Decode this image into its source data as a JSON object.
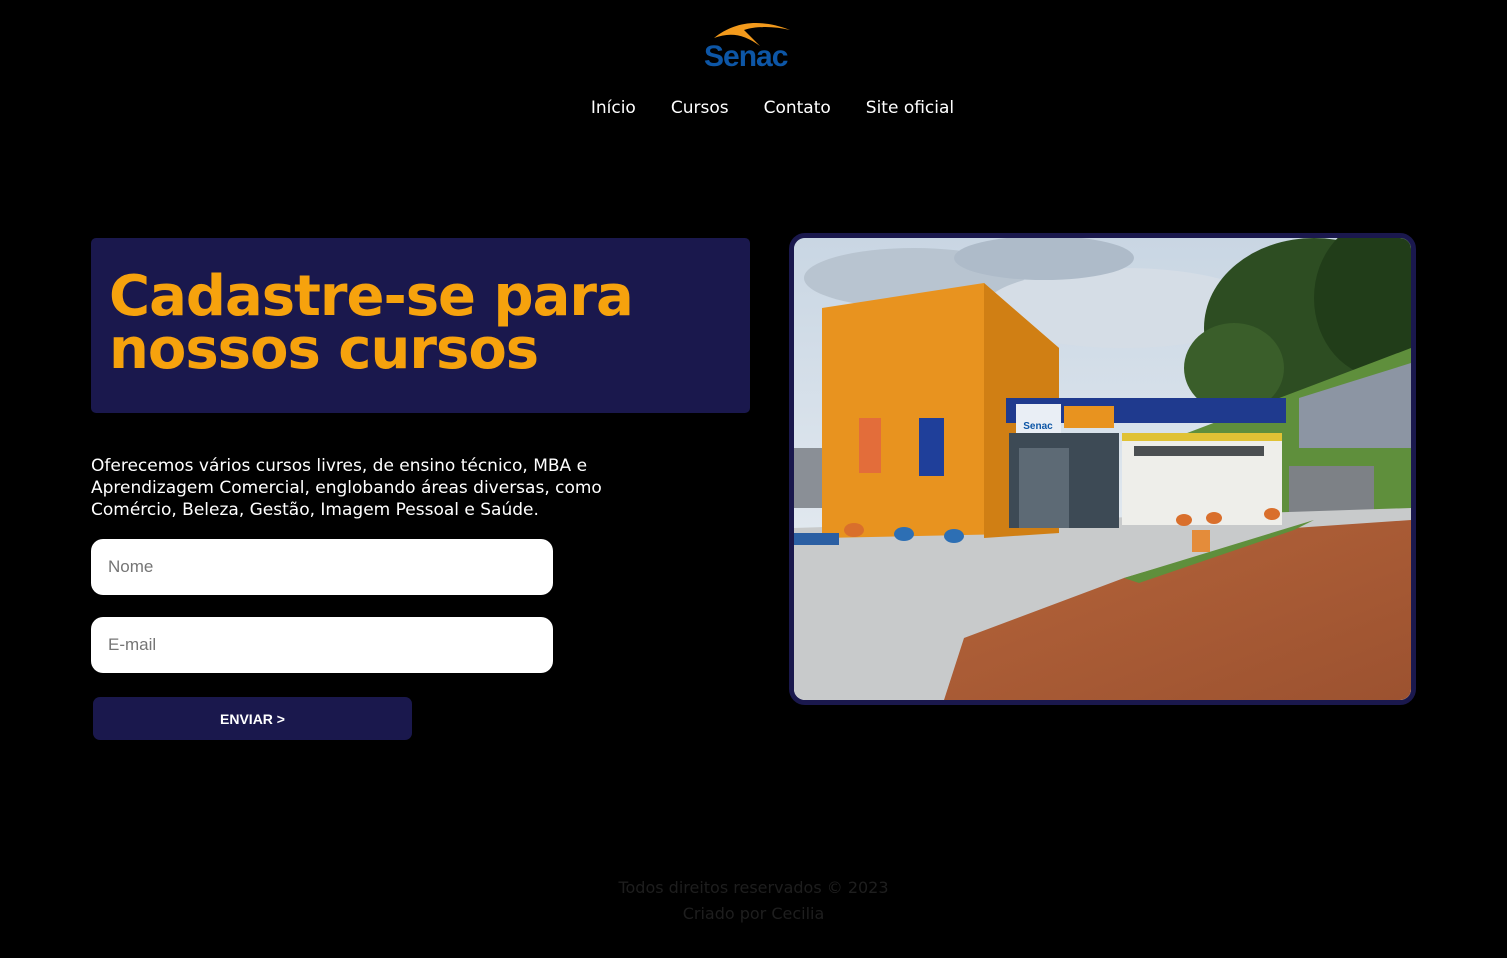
{
  "header": {
    "logo_text": "Senac",
    "nav": [
      {
        "label": "Início"
      },
      {
        "label": "Cursos"
      },
      {
        "label": "Contato"
      },
      {
        "label": "Site oficial"
      }
    ]
  },
  "hero": {
    "headline": "Cadastre-se para nossos cursos",
    "description": "Oferecemos vários cursos livres, de ensino técnico, MBA e Aprendizagem Comercial, englobando áreas diversas, como Comércio, Beleza, Gestão, Imagem Pessoal e Saúde."
  },
  "form": {
    "name_placeholder": "Nome",
    "email_placeholder": "E-mail",
    "submit_label": "ENVIAR >"
  },
  "photo": {
    "building_sign": "Senac"
  },
  "footer": {
    "rights": "Todos direitos reservados © 2023",
    "author": "Criado por Cecilia"
  },
  "colors": {
    "background": "#000000",
    "panel": "#1a184d",
    "accent": "#f6a20d",
    "logo_blue": "#0d56a6",
    "logo_orange": "#f39a1c"
  }
}
